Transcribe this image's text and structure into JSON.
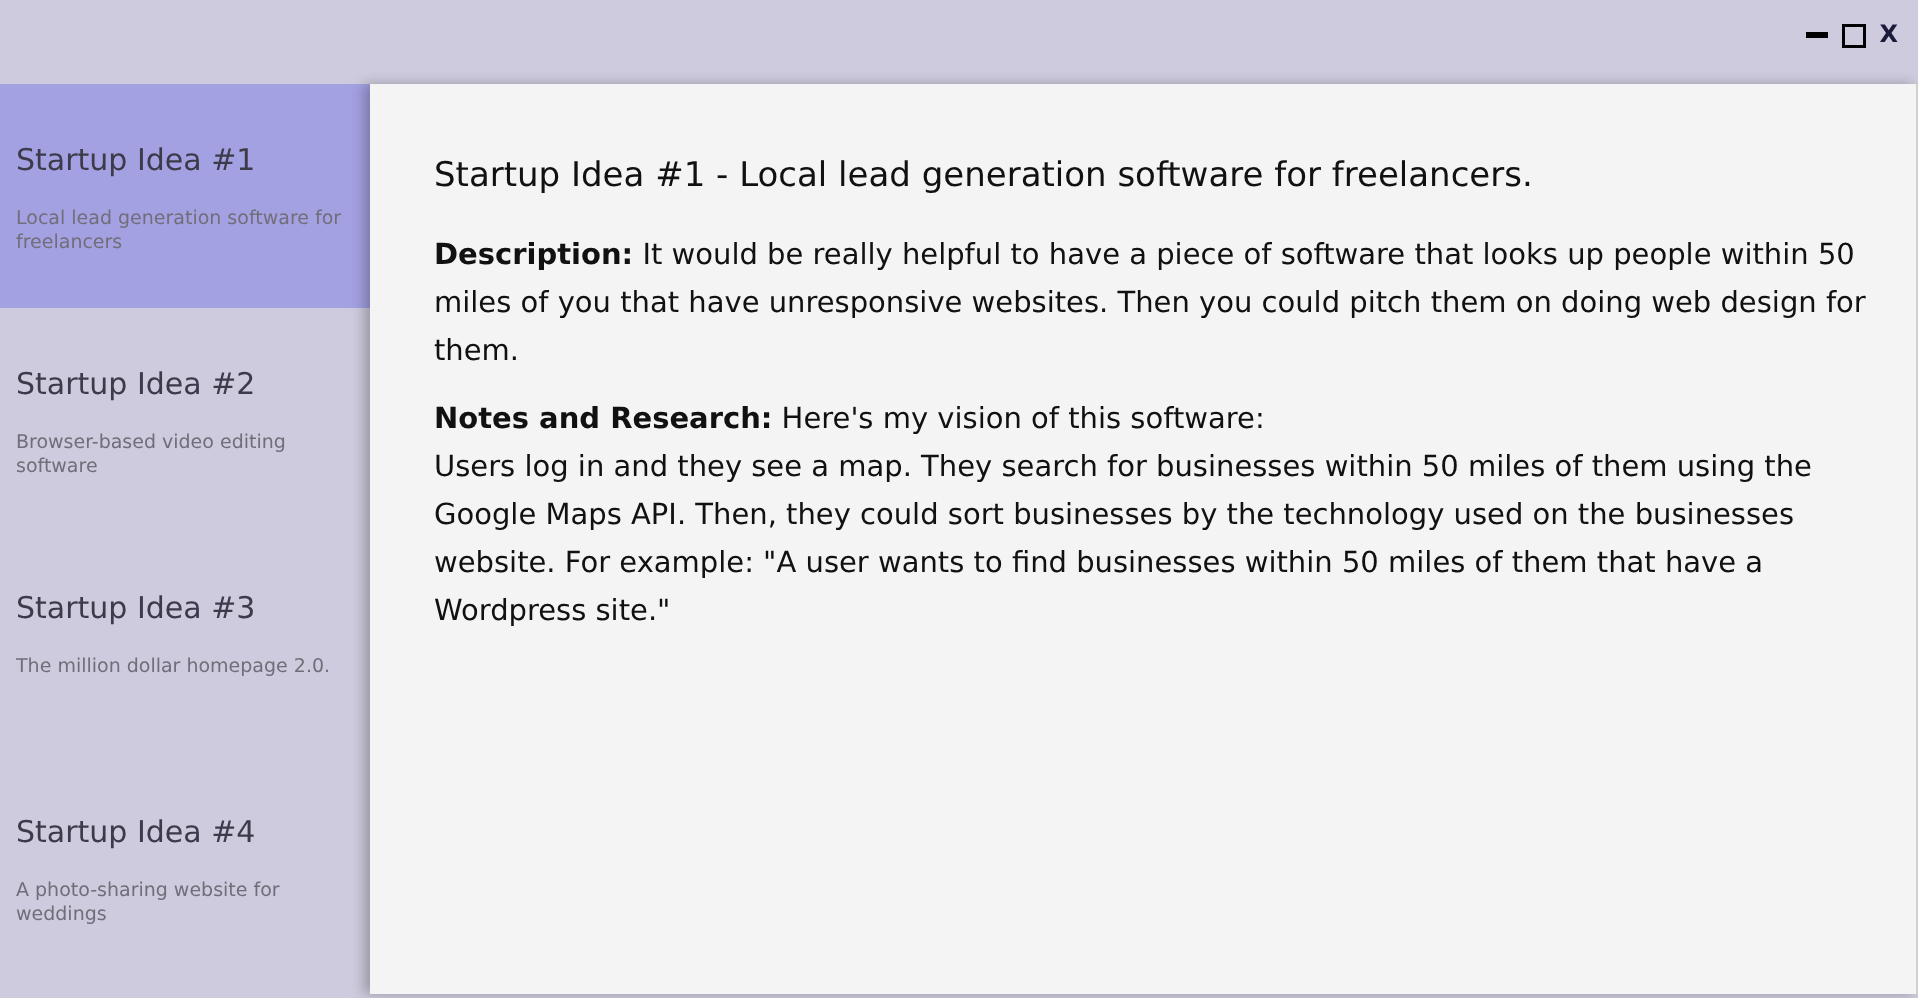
{
  "window": {
    "close_label": "X"
  },
  "sidebar": {
    "items": [
      {
        "title": "Startup Idea #1",
        "summary": "Local lead generation software for freelancers",
        "selected": true
      },
      {
        "title": "Startup Idea #2",
        "summary": "Browser-based video editing software",
        "selected": false
      },
      {
        "title": "Startup Idea #3",
        "summary": "The million dollar homepage 2.0.",
        "selected": false
      },
      {
        "title": "Startup Idea #4",
        "summary": "A photo-sharing website for weddings",
        "selected": false
      }
    ]
  },
  "detail": {
    "heading": "Startup Idea #1 - Local lead generation software for freelancers.",
    "description": "**Description:** It would be really helpful to have a piece of software that looks up people within 50 miles of you that have unresponsive websites. Then you could pitch them on doing web design for them.",
    "notes_intro": "**Notes and Research:** Here's my vision of this software:",
    "notes_body": "Users log in and they see a map. They search for businesses within 50 miles of them using the Google Maps API. Then, they could sort businesses by the technology used on the businesses website. For example: \"A user wants to find businesses within 50 miles of them that have a Wordpress site.\""
  }
}
